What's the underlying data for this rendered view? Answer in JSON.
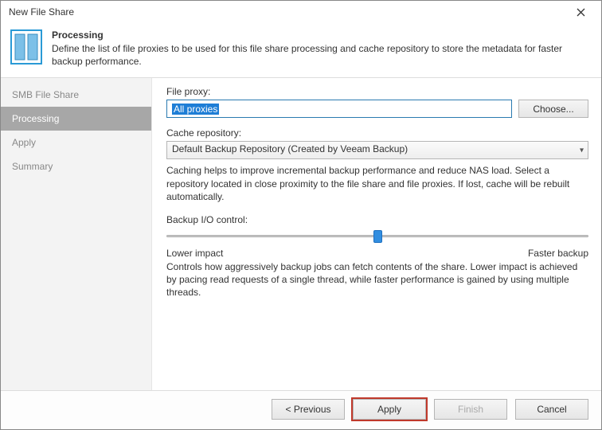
{
  "window": {
    "title": "New File Share"
  },
  "header": {
    "title": "Processing",
    "description": "Define the list of file proxies to be used for this file share processing and cache repository to store the metadata for faster backup performance."
  },
  "sidebar": {
    "items": [
      {
        "label": "SMB File Share",
        "active": false
      },
      {
        "label": "Processing",
        "active": true
      },
      {
        "label": "Apply",
        "active": false
      },
      {
        "label": "Summary",
        "active": false
      }
    ]
  },
  "main": {
    "file_proxy_label": "File proxy:",
    "file_proxy_value": "All proxies",
    "choose_button": "Choose...",
    "cache_label": "Cache repository:",
    "cache_value": "Default Backup Repository (Created by Veeam Backup)",
    "cache_desc": "Caching helps to improve incremental backup performance and reduce NAS load. Select a repository located in close proximity to the file share and file proxies. If lost, cache will be rebuilt automatically.",
    "io_label": "Backup I/O control:",
    "io_lower": "Lower impact",
    "io_faster": "Faster backup",
    "io_desc": "Controls how aggressively backup jobs can fetch contents of the share. Lower impact is achieved by pacing read requests of a single thread, while faster performance is gained by using multiple threads."
  },
  "footer": {
    "previous": "<  Previous",
    "apply": "Apply",
    "finish": "Finish",
    "cancel": "Cancel"
  }
}
